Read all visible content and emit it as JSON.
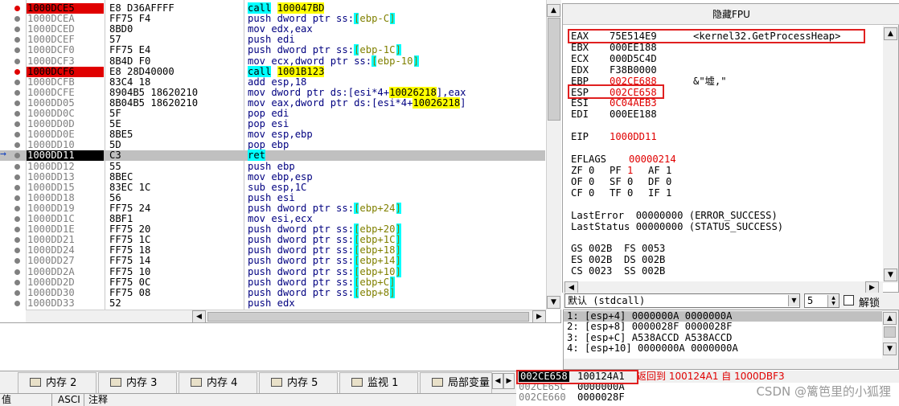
{
  "disasm": {
    "rows": [
      {
        "addr": "1000DCE5",
        "bytes": "E8 D36AFFFF",
        "ins": "call",
        "args": "100047BD",
        "marker": "bp"
      },
      {
        "addr": "1000DCEA",
        "bytes": "FF75 F4",
        "ins": "push dword ptr ss:",
        "args": "[ebp-C]",
        "marker": ""
      },
      {
        "addr": "1000DCED",
        "bytes": "8BD0",
        "ins": "mov edx,eax",
        "args": "",
        "marker": ""
      },
      {
        "addr": "1000DCEF",
        "bytes": "57",
        "ins": "push edi",
        "args": "",
        "marker": ""
      },
      {
        "addr": "1000DCF0",
        "bytes": "FF75 E4",
        "ins": "push dword ptr ss:",
        "args": "[ebp-1C]",
        "marker": ""
      },
      {
        "addr": "1000DCF3",
        "bytes": "8B4D F0",
        "ins": "mov ecx,dword ptr ss:",
        "args": "[ebp-10]",
        "marker": ""
      },
      {
        "addr": "1000DCF6",
        "bytes": "E8 28D40000",
        "ins": "call",
        "args": "1001B123",
        "marker": "bp"
      },
      {
        "addr": "1000DCFB",
        "bytes": "83C4 18",
        "ins": "add esp,18",
        "args": "",
        "marker": ""
      },
      {
        "addr": "1000DCFE",
        "bytes": "8904B5 18620210",
        "ins": "mov dword ptr ds:[esi*4+",
        "args": "10026218",
        "tail": "],eax",
        "marker": ""
      },
      {
        "addr": "1000DD05",
        "bytes": "8B04B5 18620210",
        "ins": "mov eax,dword ptr ds:[esi*4+",
        "args": "10026218",
        "tail": "]",
        "marker": ""
      },
      {
        "addr": "1000DD0C",
        "bytes": "5F",
        "ins": "pop edi",
        "args": "",
        "marker": ""
      },
      {
        "addr": "1000DD0D",
        "bytes": "5E",
        "ins": "pop esi",
        "args": "",
        "marker": ""
      },
      {
        "addr": "1000DD0E",
        "bytes": "8BE5",
        "ins": "mov esp,ebp",
        "args": "",
        "marker": ""
      },
      {
        "addr": "1000DD10",
        "bytes": "5D",
        "ins": "pop ebp",
        "args": "",
        "marker": ""
      },
      {
        "addr": "1000DD11",
        "bytes": "C3",
        "ins": "ret",
        "args": "",
        "marker": "eip"
      },
      {
        "addr": "1000DD12",
        "bytes": "55",
        "ins": "push ebp",
        "args": "",
        "marker": ""
      },
      {
        "addr": "1000DD13",
        "bytes": "8BEC",
        "ins": "mov ebp,esp",
        "args": "",
        "marker": ""
      },
      {
        "addr": "1000DD15",
        "bytes": "83EC 1C",
        "ins": "sub esp,1C",
        "args": "",
        "marker": ""
      },
      {
        "addr": "1000DD18",
        "bytes": "56",
        "ins": "push esi",
        "args": "",
        "marker": ""
      },
      {
        "addr": "1000DD19",
        "bytes": "FF75 24",
        "ins": "push dword ptr ss:",
        "args": "[ebp+24]",
        "marker": ""
      },
      {
        "addr": "1000DD1C",
        "bytes": "8BF1",
        "ins": "mov esi,ecx",
        "args": "",
        "marker": ""
      },
      {
        "addr": "1000DD1E",
        "bytes": "FF75 20",
        "ins": "push dword ptr ss:",
        "args": "[ebp+20]",
        "marker": ""
      },
      {
        "addr": "1000DD21",
        "bytes": "FF75 1C",
        "ins": "push dword ptr ss:",
        "args": "[ebp+1C]",
        "marker": ""
      },
      {
        "addr": "1000DD24",
        "bytes": "FF75 18",
        "ins": "push dword ptr ss:",
        "args": "[ebp+18]",
        "marker": ""
      },
      {
        "addr": "1000DD27",
        "bytes": "FF75 14",
        "ins": "push dword ptr ss:",
        "args": "[ebp+14]",
        "marker": ""
      },
      {
        "addr": "1000DD2A",
        "bytes": "FF75 10",
        "ins": "push dword ptr ss:",
        "args": "[ebp+10]",
        "marker": ""
      },
      {
        "addr": "1000DD2D",
        "bytes": "FF75 0C",
        "ins": "push dword ptr ss:",
        "args": "[ebp+C]",
        "marker": ""
      },
      {
        "addr": "1000DD30",
        "bytes": "FF75 08",
        "ins": "push dword ptr ss:",
        "args": "[ebp+8]",
        "marker": ""
      },
      {
        "addr": "1000DD33",
        "bytes": "52",
        "ins": "push edx",
        "args": "",
        "marker": ""
      }
    ]
  },
  "registers": {
    "title": "隐藏FPU",
    "gp": [
      {
        "name": "EAX",
        "value": "75E514E9",
        "comment": "<kernel32.GetProcessHeap>",
        "changed": false
      },
      {
        "name": "EBX",
        "value": "000EE188",
        "comment": "",
        "changed": false
      },
      {
        "name": "ECX",
        "value": "000D5C4D",
        "comment": "",
        "changed": false
      },
      {
        "name": "EDX",
        "value": "F38B0000",
        "comment": "",
        "changed": false
      },
      {
        "name": "EBP",
        "value": "002CE688",
        "comment": "&\"墟,\"",
        "changed": true
      },
      {
        "name": "ESP",
        "value": "002CE658",
        "comment": "",
        "changed": true
      },
      {
        "name": "ESI",
        "value": "0C04AEB3",
        "comment": "",
        "changed": true
      },
      {
        "name": "EDI",
        "value": "000EE188",
        "comment": "",
        "changed": false
      }
    ],
    "eip": {
      "name": "EIP",
      "value": "1000DD11"
    },
    "eflags": {
      "name": "EFLAGS",
      "value": "00000214"
    },
    "flags": [
      [
        "ZF 0",
        "PF 1",
        "AF 1"
      ],
      [
        "OF 0",
        "SF 0",
        "DF 0"
      ],
      [
        "CF 0",
        "TF 0",
        "IF 1"
      ]
    ],
    "last_error": "LastError  00000000 (ERROR_SUCCESS)",
    "last_status": "LastStatus 00000000 (STATUS_SUCCESS)",
    "segments": [
      "GS 002B  FS 0053",
      "ES 002B  DS 002B",
      "CS 0023  SS 002B"
    ]
  },
  "callconv": {
    "convention": "默认 (stdcall)",
    "count": "5",
    "unlock_label": "解锁"
  },
  "args": [
    "1: [esp+4] 0000000A 0000000A",
    "2: [esp+8] 0000028F 0000028F",
    "3: [esp+C] A538ACCD A538ACCD",
    "4: [esp+10] 0000000A 0000000A"
  ],
  "tabs": [
    {
      "label": "内存 2"
    },
    {
      "label": "内存 3"
    },
    {
      "label": "内存 4"
    },
    {
      "label": "内存 5"
    },
    {
      "label": "监视 1"
    },
    {
      "label": "局部变量"
    }
  ],
  "dump_header": {
    "col_value": "值",
    "col_ascii": "ASCI",
    "col_comment": "注释"
  },
  "stack": {
    "rows": [
      {
        "addr": "002CE658",
        "value": "100124A1",
        "comment": "返回到 100124A1 自 1000DBF3"
      },
      {
        "addr": "002CE65C",
        "value": "0000000A",
        "comment": ""
      },
      {
        "addr": "002CE660",
        "value": "0000028F",
        "comment": ""
      }
    ]
  },
  "watermark": "CSDN @篱笆里的小狐狸",
  "colors": {
    "breakpoint": "#e00000",
    "highlight_cyan": "#00ffff",
    "highlight_yellow": "#ffff00",
    "instruction": "#000080",
    "annotation_box": "#e02020"
  }
}
